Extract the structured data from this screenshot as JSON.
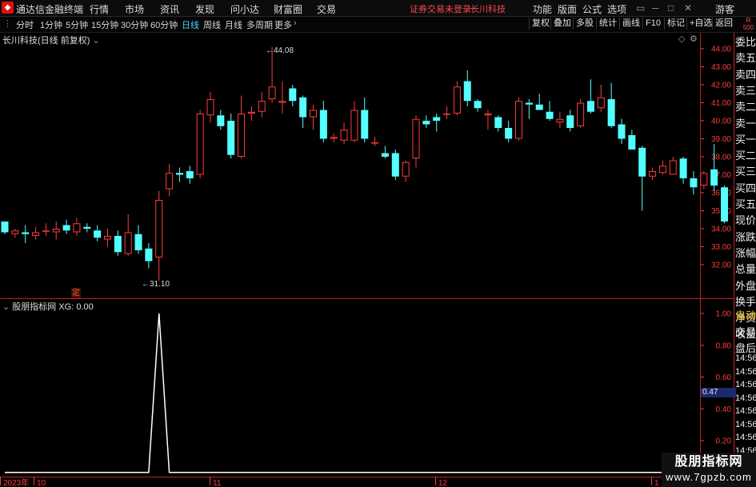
{
  "window": {
    "app_name": "通达信金融终端",
    "menu": [
      "行情",
      "市场",
      "资讯",
      "发现",
      "问小达",
      "财富圈",
      "交易"
    ],
    "warning": "证券交易未登录",
    "stock_title": "长川科技",
    "right_menu": [
      "功能",
      "版面",
      "公式",
      "选项"
    ],
    "guest": "游客"
  },
  "toolbar": {
    "periods": [
      "分时",
      "1分钟",
      "5分钟",
      "15分钟",
      "30分钟",
      "60分钟",
      "日线",
      "周线",
      "月线",
      "多周期",
      "更多"
    ],
    "active_period": "日线",
    "right_buttons": [
      "复权",
      "叠加",
      "多股",
      "统计",
      "画线",
      "F10",
      "标记",
      "+自选",
      "返回"
    ],
    "badge_top": "R",
    "badge_bottom": "500"
  },
  "main_chart": {
    "header": "长川科技(日线 前复权)",
    "y_ticks": [
      "44.00",
      "43.00",
      "42.00",
      "41.00",
      "40.00",
      "39.00",
      "38.00",
      "37.00",
      "36.00",
      "35.00",
      "34.00",
      "33.00",
      "32.00"
    ],
    "high_label": "44.08",
    "low_label": "31.10",
    "marker": "定"
  },
  "indicator": {
    "header": "股朋指标网 XG: 0.00",
    "y_ticks": [
      "1.00",
      "0.80",
      "0.60",
      "0.40",
      "0.20"
    ],
    "current_value": "0.47"
  },
  "side_panel": {
    "items": [
      "委比",
      "卖五",
      "卖四",
      "卖三",
      "卖二",
      "卖一",
      "买一",
      "买二",
      "买三",
      "买四",
      "买五",
      "现价",
      "涨跌",
      "涨幅",
      "总量",
      "外盘",
      "换手",
      "净资",
      "收益"
    ],
    "lower_items": [
      "自动",
      "交易",
      "盘后"
    ],
    "times": [
      "14:56",
      "14:56",
      "14:56",
      "14:56",
      "14:56",
      "14:56",
      "14:56",
      "14:56",
      "14:56"
    ]
  },
  "time_axis": {
    "labels": [
      "2023年",
      "10",
      "11",
      "12",
      "1"
    ]
  },
  "watermark": {
    "line1": "股朋指标网",
    "line2": "www.7gpzb.com"
  },
  "colors": {
    "up": "#ff3c3c",
    "down": "#54ffff",
    "axis": "#ff3c3c",
    "indicator_line": "#ffffff"
  },
  "chart_data": {
    "type": "candlestick",
    "ylim": [
      31.5,
      44.5
    ],
    "candles": [
      [
        34.4,
        33.8,
        34.4,
        33.7
      ],
      [
        33.7,
        33.9,
        34.0,
        33.5
      ],
      [
        33.8,
        33.7,
        34.2,
        33.2
      ],
      [
        33.6,
        33.8,
        34.1,
        33.4
      ],
      [
        33.9,
        33.9,
        34.3,
        33.6
      ],
      [
        33.8,
        34.0,
        34.4,
        33.4
      ],
      [
        34.2,
        33.9,
        34.5,
        33.7
      ],
      [
        33.8,
        34.3,
        34.6,
        33.6
      ],
      [
        34.1,
        34.0,
        34.3,
        33.8
      ],
      [
        33.9,
        33.5,
        34.2,
        33.3
      ],
      [
        33.4,
        33.6,
        34.0,
        33.0
      ],
      [
        33.6,
        32.7,
        33.9,
        32.5
      ],
      [
        32.6,
        33.8,
        34.8,
        32.5
      ],
      [
        33.7,
        32.8,
        34.2,
        32.6
      ],
      [
        32.9,
        32.2,
        33.2,
        31.8
      ],
      [
        32.4,
        35.6,
        36.1,
        31.1
      ],
      [
        36.2,
        37.1,
        37.6,
        35.8
      ],
      [
        37.1,
        37.0,
        37.4,
        36.6
      ],
      [
        37.2,
        36.8,
        37.5,
        36.5
      ],
      [
        37.0,
        40.4,
        40.6,
        36.8
      ],
      [
        40.3,
        41.2,
        41.6,
        39.9
      ],
      [
        40.3,
        39.7,
        40.6,
        39.5
      ],
      [
        40.0,
        38.1,
        40.4,
        37.9
      ],
      [
        38.0,
        40.4,
        41.4,
        37.9
      ],
      [
        40.4,
        40.5,
        40.8,
        40.0
      ],
      [
        40.5,
        41.1,
        41.6,
        40.2
      ],
      [
        41.2,
        41.9,
        44.1,
        41.0
      ],
      [
        41.0,
        41.1,
        42.2,
        40.4
      ],
      [
        41.8,
        41.1,
        42.0,
        40.8
      ],
      [
        41.3,
        40.2,
        41.4,
        39.6
      ],
      [
        40.2,
        40.6,
        40.9,
        39.5
      ],
      [
        40.6,
        39.0,
        41.1,
        38.8
      ],
      [
        39.0,
        39.1,
        39.3,
        38.8
      ],
      [
        38.9,
        39.5,
        39.9,
        38.7
      ],
      [
        38.9,
        40.6,
        41.1,
        38.8
      ],
      [
        40.6,
        39.0,
        41.3,
        38.8
      ],
      [
        38.8,
        38.8,
        39.1,
        38.6
      ],
      [
        38.2,
        38.0,
        38.6,
        37.9
      ],
      [
        38.2,
        36.9,
        38.4,
        36.7
      ],
      [
        36.9,
        37.7,
        37.8,
        36.6
      ],
      [
        37.9,
        40.1,
        40.3,
        37.4
      ],
      [
        40.0,
        39.8,
        40.3,
        39.6
      ],
      [
        40.2,
        40.0,
        40.4,
        39.4
      ],
      [
        40.4,
        40.4,
        40.8,
        40.1
      ],
      [
        40.4,
        41.9,
        42.2,
        40.3
      ],
      [
        42.2,
        41.1,
        42.8,
        40.8
      ],
      [
        41.1,
        40.7,
        41.2,
        40.5
      ],
      [
        40.3,
        40.4,
        40.6,
        39.5
      ],
      [
        40.2,
        39.6,
        40.3,
        39.4
      ],
      [
        39.6,
        39.0,
        40.0,
        38.8
      ],
      [
        39.0,
        41.1,
        41.3,
        38.9
      ],
      [
        41.0,
        40.9,
        41.2,
        40.1
      ],
      [
        40.9,
        40.6,
        41.5,
        40.6
      ],
      [
        40.5,
        40.1,
        41.1,
        40.0
      ],
      [
        39.9,
        40.1,
        40.5,
        39.6
      ],
      [
        40.3,
        39.6,
        40.6,
        39.4
      ],
      [
        39.7,
        41.0,
        41.2,
        39.6
      ],
      [
        41.1,
        40.5,
        42.3,
        40.4
      ],
      [
        40.7,
        41.3,
        42.0,
        40.5
      ],
      [
        41.2,
        39.7,
        42.1,
        39.6
      ],
      [
        39.8,
        39.0,
        40.1,
        38.7
      ],
      [
        39.2,
        38.4,
        39.5,
        38.4
      ],
      [
        38.5,
        36.9,
        38.6,
        35.0
      ],
      [
        36.9,
        37.2,
        37.4,
        36.7
      ],
      [
        37.1,
        37.5,
        37.8,
        37.0
      ],
      [
        37.0,
        37.8,
        38.0,
        37.5
      ],
      [
        37.9,
        36.8,
        38.0,
        36.5
      ],
      [
        36.8,
        36.3,
        37.2,
        35.9
      ],
      [
        36.4,
        37.1,
        37.2,
        36.2
      ],
      [
        37.3,
        36.4,
        38.7,
        36.1
      ],
      [
        36.3,
        34.4,
        36.4,
        34.3
      ]
    ]
  },
  "indicator_data": {
    "type": "line",
    "ylim": [
      0,
      1.05
    ],
    "spike_index": 15,
    "count": 71
  }
}
